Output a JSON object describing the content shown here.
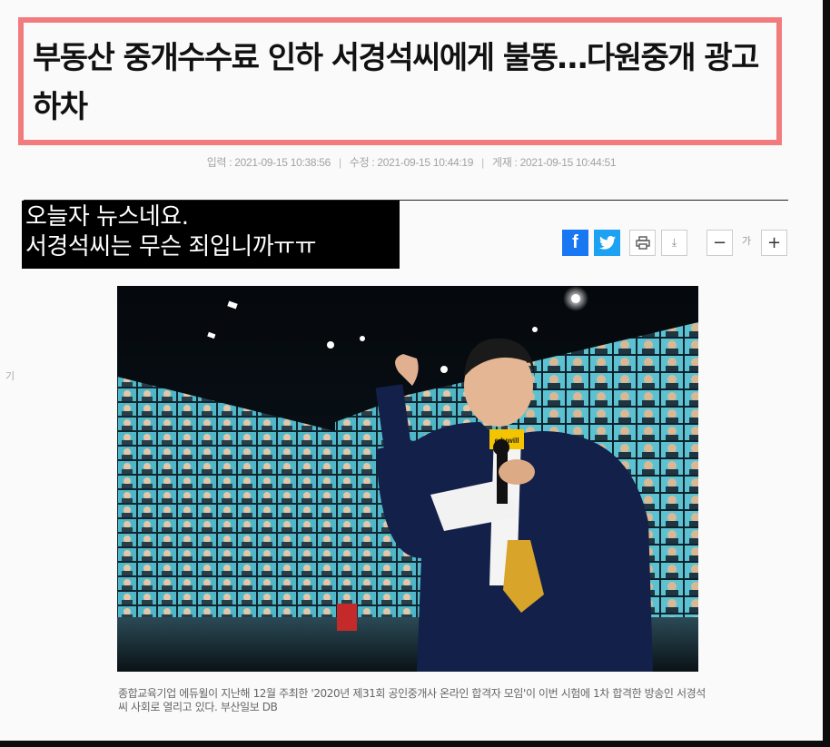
{
  "article": {
    "headline": "부동산 중개수수료 인하 서경석씨에게 불똥…다원중개 광고하차",
    "meta": {
      "input": "입력 : 2021-09-15 10:38:56",
      "modified": "수정 : 2021-09-15 10:44:19",
      "published": "게재 : 2021-09-15 10:44:51"
    },
    "overlay_lines": [
      "오늘자 뉴스네요.",
      "서경석씨는 무슨 죄입니까ㅠㅠ"
    ],
    "photo": {
      "mic_brand": "eduwill"
    },
    "photo_caption": "종합교육기업 에듀윌이 지난해 12월 주최한 '2020년 제31회 공인중개사 온라인 합격자 모임'이 이번 시험에 1차 합격한 방송인 서경석 씨 사회로 열리고 있다. 부산일보 DB"
  },
  "toolbar": {
    "facebook_glyph": "f",
    "font_size_label": "가",
    "minus_glyph": "−",
    "plus_glyph": "+",
    "download_glyph": "⤓"
  },
  "side_char": "기",
  "colors": {
    "highlight_border": "#f27b7e",
    "facebook": "#1877f2",
    "twitter": "#1da1f2"
  }
}
